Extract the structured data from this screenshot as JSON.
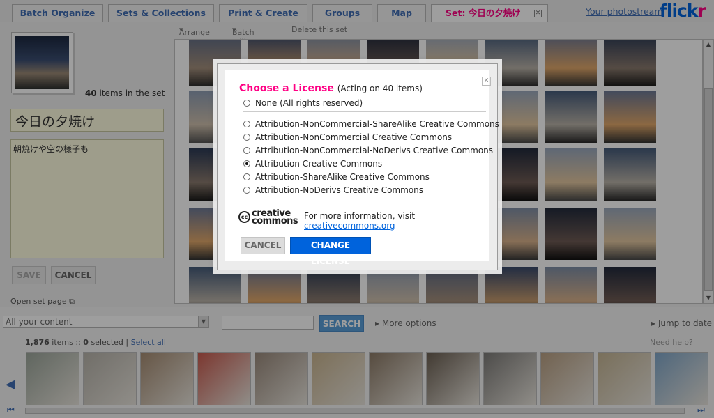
{
  "tabs": [
    {
      "label": "Batch Organize",
      "active": false
    },
    {
      "label": "Sets & Collections",
      "active": false
    },
    {
      "label": "Print & Create",
      "active": false
    },
    {
      "label": "Groups",
      "active": false
    },
    {
      "label": "Map",
      "active": false
    },
    {
      "label": "Set: 今日の夕焼け",
      "active": true
    }
  ],
  "header": {
    "photostream_link": "Your photostream",
    "logo_fl": "flick",
    "logo_r": "r"
  },
  "toolbar": {
    "arrange": "Arrange",
    "batch_edit": "Batch edit",
    "delete_set": "Delete this set"
  },
  "set": {
    "count": "40",
    "count_suffix": " items in the set",
    "title": "今日の夕焼け",
    "description": "朝焼けや空の様子も",
    "save_label": "SAVE",
    "cancel_label": "CANCEL",
    "open_set_page": "Open set page"
  },
  "bottom": {
    "content_select": "All your content",
    "search_label": "SEARCH",
    "more_options": "More options",
    "jump_to_date": "Jump to date",
    "items_count": "1,876",
    "items_word": "items",
    "selected_count": "0",
    "selected_word": "selected",
    "select_all": "Select all",
    "need_help": "Need help?"
  },
  "modal": {
    "title": "Choose a License",
    "acting_on": "(Acting on 40 items)",
    "options": [
      "None (All rights reserved)",
      "Attribution-NonCommercial-ShareAlike Creative Commons",
      "Attribution-NonCommercial Creative Commons",
      "Attribution-NonCommercial-NoDerivs Creative Commons",
      "Attribution Creative Commons",
      "Attribution-ShareAlike Creative Commons",
      "Attribution-NoDerivs Creative Commons"
    ],
    "selected_option": 4,
    "cc_logo_top": "creative",
    "cc_logo_bottom": "commons",
    "cc_logo_mark": "cc",
    "info_text": "For more information, visit ",
    "info_link": "creativecommons.org",
    "cancel_label": "CANCEL",
    "change_label": "CHANGE LICENSE"
  },
  "colors": {
    "accent_pink": "#ff0084",
    "accent_blue": "#0063dc",
    "link_blue": "#3f6db3"
  }
}
